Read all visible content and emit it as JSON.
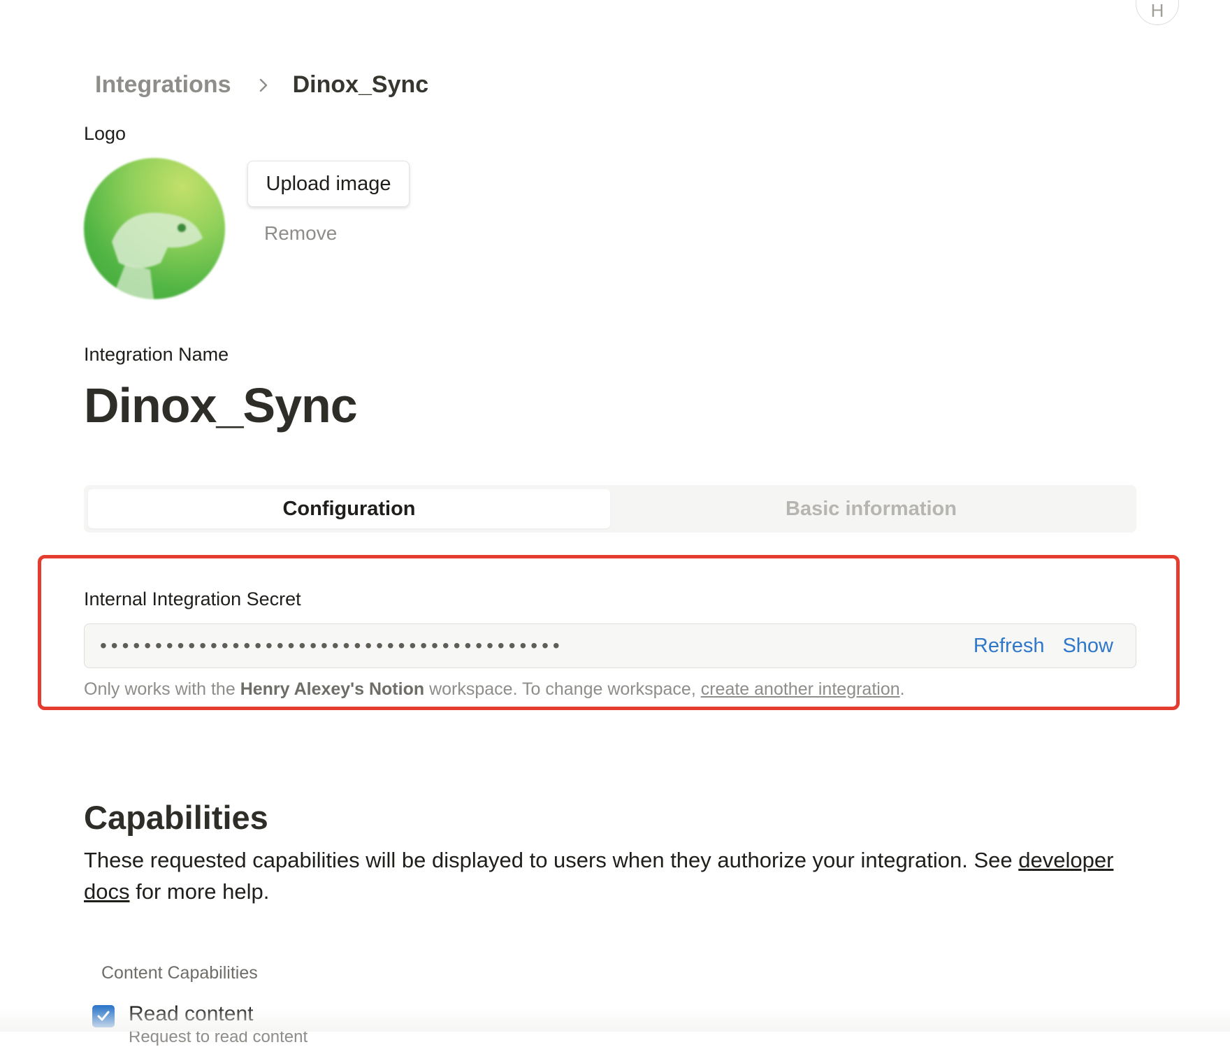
{
  "user": {
    "avatar_initial": "H"
  },
  "breadcrumb": {
    "parent": "Integrations",
    "current": "Dinox_Sync"
  },
  "logo": {
    "label": "Logo",
    "upload_label": "Upload image",
    "remove_label": "Remove"
  },
  "integration": {
    "name_label": "Integration Name",
    "name": "Dinox_Sync"
  },
  "tabs": [
    {
      "label": "Configuration",
      "active": true
    },
    {
      "label": "Basic information",
      "active": false
    }
  ],
  "secret": {
    "label": "Internal Integration Secret",
    "masked_value": "••••••••••••••••••••••••••••••••••••••••••",
    "refresh_label": "Refresh",
    "show_label": "Show",
    "hint_prefix": "Only works with the ",
    "hint_workspace": "Henry Alexey's Notion",
    "hint_middle": " workspace. To change workspace, ",
    "hint_link": "create another integration",
    "hint_suffix": "."
  },
  "capabilities": {
    "title": "Capabilities",
    "desc_prefix": "These requested capabilities will be displayed to users when they authorize your integration. See ",
    "desc_link": "developer docs",
    "desc_suffix": " for more help.",
    "content_label": "Content Capabilities",
    "items": [
      {
        "label": "Read content",
        "checked": true,
        "description": "Request to read content"
      }
    ]
  },
  "colors": {
    "accent": "#2f78c9",
    "highlight": "#e43d2f",
    "text": "#37352f"
  }
}
